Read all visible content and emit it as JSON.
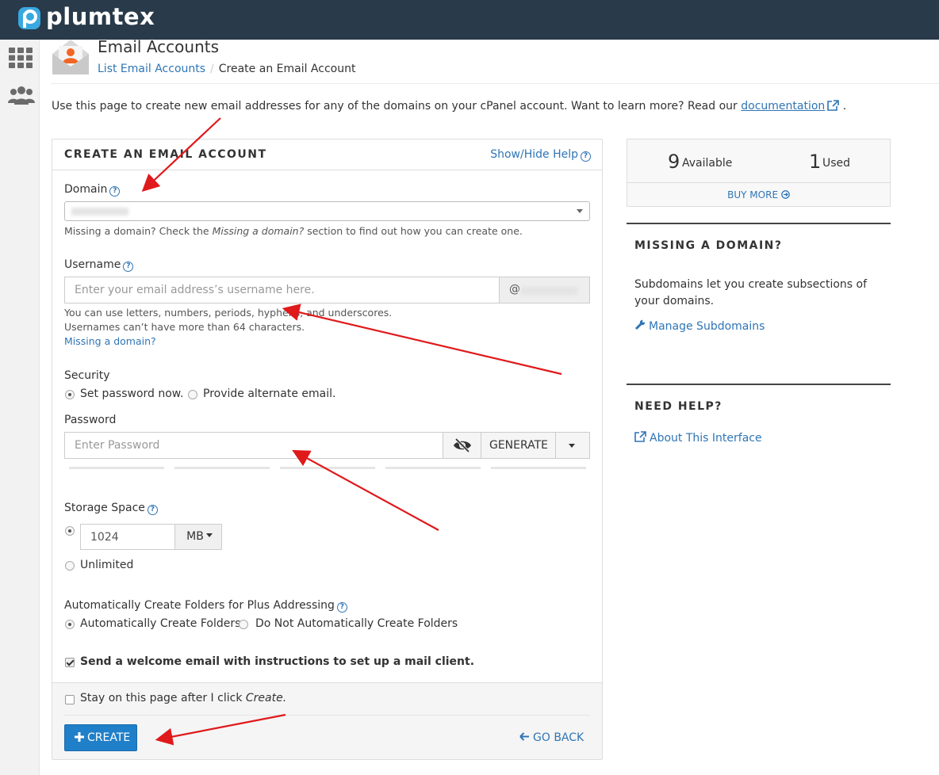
{
  "brand": {
    "name": "plumtex",
    "bar_color": "#293a4a",
    "accent": "#2f75b5"
  },
  "sidebar": {
    "items": [
      {
        "icon": "grid-icon"
      },
      {
        "icon": "users-icon"
      }
    ]
  },
  "header": {
    "title": "Email Accounts",
    "breadcrumb": {
      "parent": "List Email Accounts",
      "separator": "/",
      "current": "Create an Email Account"
    }
  },
  "intro": {
    "text": "Use this page to create new email addresses for any of the domains on your cPanel account. Want to learn more? Read our ",
    "link": "documentation",
    "end": "."
  },
  "form": {
    "title": "CREATE AN EMAIL ACCOUNT",
    "help_toggle": "Show/Hide Help",
    "domain": {
      "label": "Domain",
      "help_pre": "Missing a domain? Check the ",
      "help_em": "Missing a domain?",
      "help_post": " section to find out how you can create one."
    },
    "username": {
      "label": "Username",
      "placeholder": "Enter your email address’s username here.",
      "at": "@",
      "help1": "You can use letters, numbers, periods, hyphens, and underscores.",
      "help2": "Usernames can’t have more than 64 characters.",
      "missing_link": "Missing a domain?"
    },
    "security": {
      "label": "Security",
      "options": [
        "Set password now.",
        "Provide alternate email."
      ],
      "selected": 0
    },
    "password": {
      "label": "Password",
      "placeholder": "Enter Password",
      "generate": "GENERATE"
    },
    "storage": {
      "label": "Storage Space",
      "value": "1024",
      "unit": "MB",
      "unlimited": "Unlimited"
    },
    "plus_addressing": {
      "label": "Automatically Create Folders for Plus Addressing",
      "options": [
        "Automatically Create Folders",
        "Do Not Automatically Create Folders"
      ],
      "selected": 0
    },
    "welcome": {
      "label": "Send a welcome email with instructions to set up a mail client.",
      "checked": true
    },
    "stay": {
      "label_pre": "Stay on this page after I click ",
      "label_em": "Create.",
      "checked": false
    },
    "create_button": "CREATE",
    "go_back": "GO BACK"
  },
  "stats": {
    "available_count": "9",
    "available_label": "Available",
    "used_count": "1",
    "used_label": "Used",
    "buy_more": "BUY MORE"
  },
  "missing_domain": {
    "title": "MISSING A DOMAIN?",
    "text": "Subdomains let you create subsections of your domains.",
    "link": "Manage Subdomains"
  },
  "need_help": {
    "title": "NEED HELP?",
    "link": "About This Interface"
  },
  "annotation_color": "#e0191b"
}
